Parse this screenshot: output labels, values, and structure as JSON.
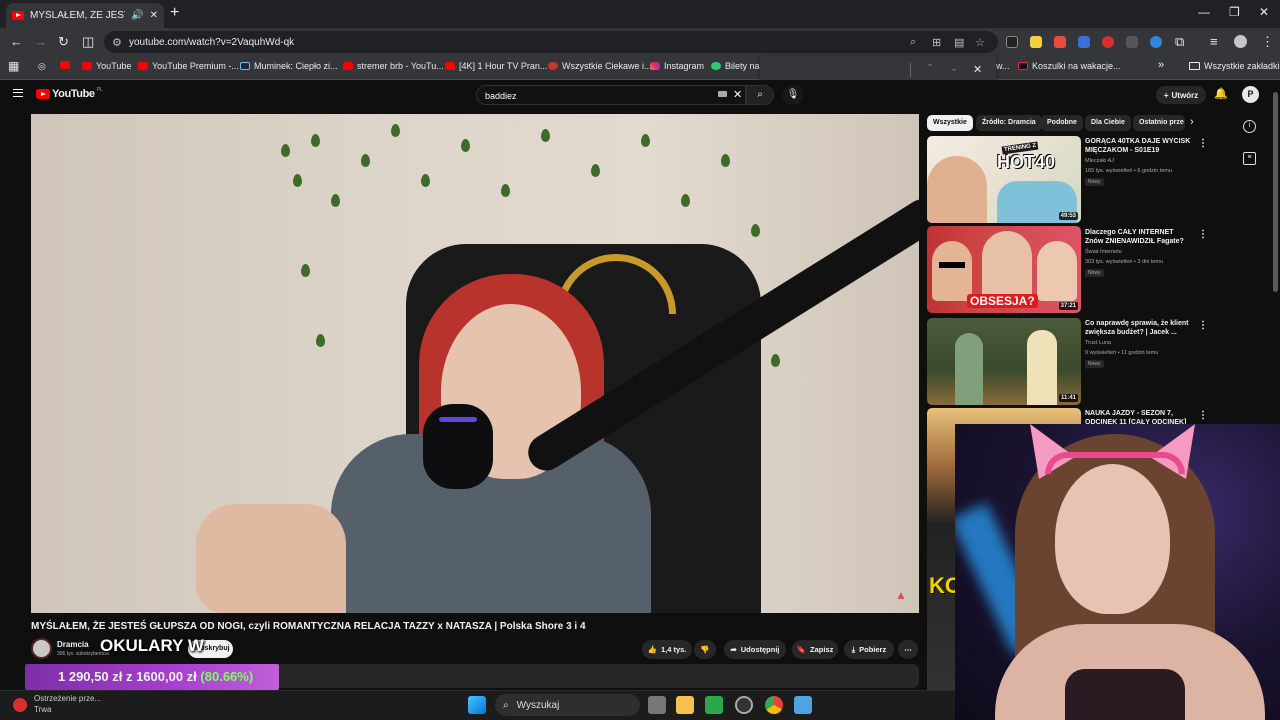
{
  "browser": {
    "tab_title": "MYŚLAŁEM, ŻE JESTEŚ GŁUPSZA",
    "url": "youtube.com/watch?v=2VaquhWd-qk",
    "bookmarks": [
      "YouTube",
      "YouTube Premium -...",
      "Muminek: Ciepło zi...",
      "stremer brb - YouTu...",
      "[4K] 1 Hour TV Pran...",
      "Wszystkie Ciekawe i...",
      "Instagram",
      "Bilety na i",
      "Koszulki na wakacje...",
      "Wszystkie zakładki"
    ],
    "bookmark_partial": "w..."
  },
  "youtube": {
    "logo": "YouTube",
    "country": "PL",
    "search_value": "baddiez",
    "create_label": "Utwórz",
    "avatar_letter": "P"
  },
  "video": {
    "title": "MYŚLAŁEM, ŻE JESTEŚ GŁUPSZA OD NOGI, czyli ROMANTYCZNA RELACJA TAZZY x NATASZA | Polska Shore 3 i 4",
    "channel": "Dramcia",
    "subscribers": "306 tys. subskrybentów",
    "subscribe_label": "Subskrybuj",
    "likes": "1,4 tys.",
    "share": "Udostępnij",
    "save": "Zapisz",
    "download": "Pobierz"
  },
  "overlay": {
    "okulary": "OKULARY W",
    "donation_current": "1 290,50 zł",
    "donation_sep": "z",
    "donation_goal": "1600,00 zł",
    "donation_pct": "(80.66%)"
  },
  "sidebar": {
    "chips": [
      "Wszystkie",
      "Źródło: Dramcia",
      "Podobne",
      "Dla Ciebie",
      "Ostatnio prze"
    ],
    "videos": [
      {
        "title": "GORĄCA 40TKA DAJE WYCISK MIĘCZAKOM - S01E19",
        "channel": "Mleczaki AJ",
        "meta": "165 tys. wyświetleń • 6 godzin temu",
        "badge": "Nowy",
        "duration": "49:53",
        "thumb_text": "HOT40",
        "thumb_sub": "TRENING Z"
      },
      {
        "title": "Dlaczego CAŁY INTERNET Znów ZNIENAWIDZIŁ Fagate?",
        "channel": "Świat Internetu",
        "meta": "303 tys. wyświetleń • 3 dni temu",
        "badge": "Nowy",
        "duration": "37:21",
        "thumb_text": "OBSESJA?"
      },
      {
        "title": "Co naprawdę sprawia, że klient zwiększa budżet? | Jacek ...",
        "channel": "Trust Luna",
        "meta": "9 wyświetleń • 11 godzin temu",
        "badge": "Nowy",
        "duration": "11:41"
      },
      {
        "title": "NAUKA JAZDY - SEZON 7, ODCINEK 11 [CAŁY ODCINEK]",
        "channel": "",
        "meta": "",
        "badge": "",
        "duration": ""
      }
    ]
  },
  "taskbar": {
    "search_placeholder": "Wyszukaj",
    "warning_title": "Ostrzeżenie prze...",
    "warning_sub": "Trwa"
  },
  "colors": {
    "accent_red": "#ff0000",
    "donation_purple": "#a93fd0",
    "donation_green": "#7dff5f"
  }
}
